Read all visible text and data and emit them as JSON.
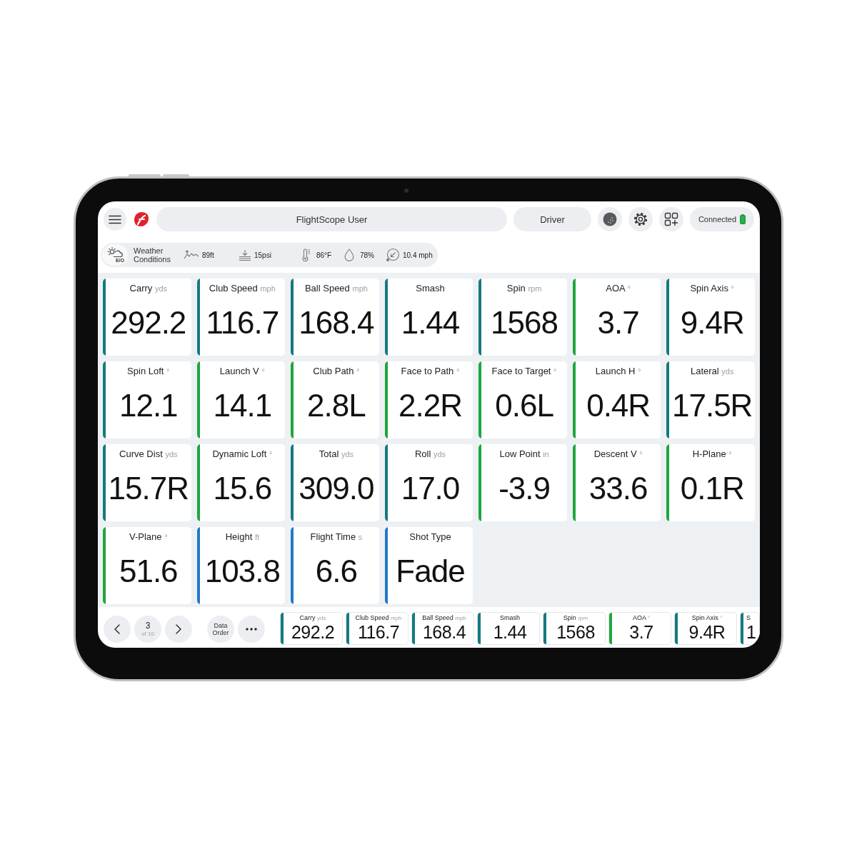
{
  "top_bar": {
    "user": "FlightScope User",
    "club": "Driver",
    "status": "Connected"
  },
  "weather": {
    "mode": "E/O",
    "title": "Weather Conditions",
    "items": [
      {
        "kind": "altitude",
        "value": "89ft"
      },
      {
        "kind": "pressure",
        "value": "15psi"
      },
      {
        "kind": "temperature",
        "value": "86°F"
      },
      {
        "kind": "humidity",
        "value": "78%"
      },
      {
        "kind": "wind",
        "value": "10.4 mph"
      }
    ]
  },
  "metrics": [
    {
      "label": "Carry",
      "unit": "yds",
      "value": "292.2",
      "color": "#137a80"
    },
    {
      "label": "Club Speed",
      "unit": "mph",
      "value": "116.7",
      "color": "#137a80"
    },
    {
      "label": "Ball Speed",
      "unit": "mph",
      "value": "168.4",
      "color": "#137a80"
    },
    {
      "label": "Smash",
      "value": "1.44",
      "color": "#137a80"
    },
    {
      "label": "Spin",
      "unit": "rpm",
      "value": "1568",
      "color": "#137a80"
    },
    {
      "label": "AOA",
      "unit": "°",
      "value": "3.7",
      "color": "#1fa63c"
    },
    {
      "label": "Spin Axis",
      "unit": "°",
      "value": "9.4R",
      "color": "#137a80"
    },
    {
      "label": "Spin Loft",
      "unit": "°",
      "value": "12.1",
      "color": "#137a80"
    },
    {
      "label": "Launch V",
      "unit": "°",
      "value": "14.1",
      "color": "#1fa63c"
    },
    {
      "label": "Club Path",
      "unit": "°",
      "value": "2.8L",
      "color": "#1fa63c"
    },
    {
      "label": "Face to Path",
      "unit": "°",
      "value": "2.2R",
      "color": "#1fa63c"
    },
    {
      "label": "Face to Target",
      "unit": "°",
      "value": "0.6L",
      "color": "#1fa63c"
    },
    {
      "label": "Launch H",
      "unit": "°",
      "value": "0.4R",
      "color": "#1fa63c"
    },
    {
      "label": "Lateral",
      "unit": "yds",
      "value": "17.5R",
      "color": "#137a80"
    },
    {
      "label": "Curve Dist",
      "unit": "yds",
      "value": "15.7R",
      "color": "#137a80"
    },
    {
      "label": "Dynamic Loft",
      "unit": "°",
      "value": "15.6",
      "color": "#1fa63c"
    },
    {
      "label": "Total",
      "unit": "yds",
      "value": "309.0",
      "color": "#137a80"
    },
    {
      "label": "Roll",
      "unit": "yds",
      "value": "17.0",
      "color": "#137a80"
    },
    {
      "label": "Low Point",
      "unit": "in",
      "value": "-3.9",
      "color": "#1fa63c"
    },
    {
      "label": "Descent V",
      "unit": "°",
      "value": "33.6",
      "color": "#1fa63c"
    },
    {
      "label": "H-Plane",
      "unit": "°",
      "value": "0.1R",
      "color": "#1fa63c"
    },
    {
      "label": "V-Plane",
      "unit": "°",
      "value": "51.6",
      "color": "#1fa63c"
    },
    {
      "label": "Height",
      "unit": "ft",
      "value": "103.8",
      "color": "#2378c8"
    },
    {
      "label": "Flight Time",
      "unit": "s",
      "value": "6.6",
      "color": "#2378c8"
    },
    {
      "label": "Shot Type",
      "value": "Fade",
      "color": "#2378c8"
    }
  ],
  "bottom_bar": {
    "shot": "3",
    "shot_total": "of 10",
    "data_order": "Data Order",
    "strip": [
      {
        "label": "Carry",
        "unit": "yds",
        "value": "292.2",
        "color": "#137a80"
      },
      {
        "label": "Club Speed",
        "unit": "mph",
        "value": "116.7",
        "color": "#137a80"
      },
      {
        "label": "Ball Speed",
        "unit": "mph",
        "value": "168.4",
        "color": "#137a80"
      },
      {
        "label": "Smash",
        "value": "1.44",
        "color": "#137a80"
      },
      {
        "label": "Spin",
        "unit": "rpm",
        "value": "1568",
        "color": "#137a80"
      },
      {
        "label": "AOA",
        "unit": "°",
        "value": "3.7",
        "color": "#1fa63c"
      },
      {
        "label": "Spin Axis",
        "unit": "°",
        "value": "9.4R",
        "color": "#137a80"
      },
      {
        "label": "S",
        "value": "1",
        "color": "#137a80"
      }
    ]
  }
}
